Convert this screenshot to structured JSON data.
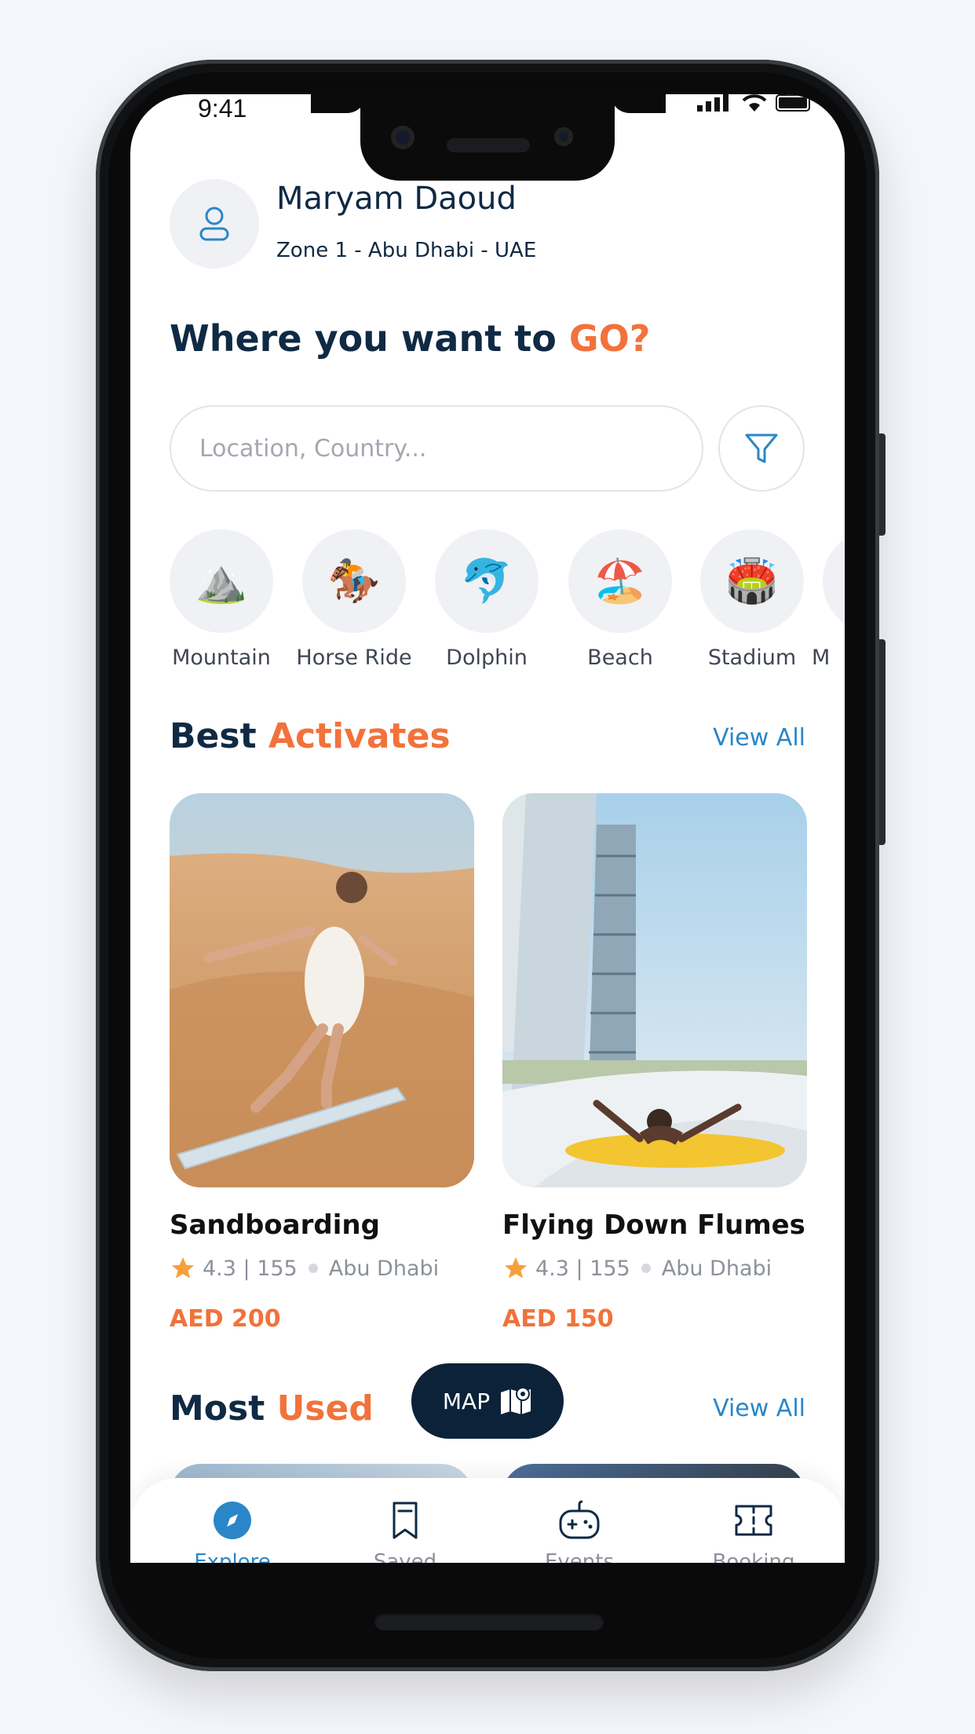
{
  "status": {
    "time": "9:41"
  },
  "user": {
    "name": "Maryam Daoud",
    "location": "Zone 1 - Abu Dhabi - UAE"
  },
  "headline": {
    "prefix": "Where you want to ",
    "accent": "GO?"
  },
  "search": {
    "placeholder": "Location, Country..."
  },
  "categories": [
    {
      "label": "Mountain",
      "icon": "⛰️"
    },
    {
      "label": "Horse Ride",
      "icon": "🏇"
    },
    {
      "label": "Dolphin",
      "icon": "🐬"
    },
    {
      "label": "Beach",
      "icon": "🏖️"
    },
    {
      "label": "Stadium",
      "icon": "🏟️"
    },
    {
      "label": "M",
      "icon": ""
    }
  ],
  "best": {
    "title_a": "Best ",
    "title_b": "Activates",
    "view_all": "View All",
    "cards": [
      {
        "title": "Sandboarding",
        "rating": "4.3 | 155",
        "place": "Abu Dhabi",
        "price": "AED 200"
      },
      {
        "title": "Flying Down Flumes",
        "rating": "4.3 | 155",
        "place": "Abu Dhabi",
        "price": "AED 150"
      }
    ]
  },
  "most_used": {
    "title_a": "Most ",
    "title_b": "Used",
    "view_all": "View All"
  },
  "map_button": {
    "label": "MAP"
  },
  "nav": [
    {
      "label": "Explore",
      "icon": "compass-icon",
      "active": true
    },
    {
      "label": "Saved",
      "icon": "bookmark-icon"
    },
    {
      "label": "Events",
      "icon": "gamepad-icon"
    },
    {
      "label": "Booking",
      "icon": "ticket-icon"
    }
  ],
  "colors": {
    "navy": "#0f2a44",
    "accent": "#f2723b",
    "link": "#2a86c8",
    "map_button": "#0c2238"
  }
}
